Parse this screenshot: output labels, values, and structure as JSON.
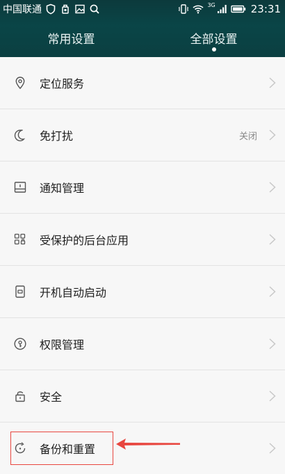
{
  "status_bar": {
    "carrier": "中国联通",
    "network": "3G",
    "time": "23:31"
  },
  "tabs": [
    {
      "label": "常用设置",
      "active": false
    },
    {
      "label": "全部设置",
      "active": true
    }
  ],
  "settings": [
    {
      "label": "定位服务",
      "icon": "location-icon",
      "value": ""
    },
    {
      "label": "免打扰",
      "icon": "moon-icon",
      "value": "关闭"
    },
    {
      "label": "通知管理",
      "icon": "notification-icon",
      "value": ""
    },
    {
      "label": "受保护的后台应用",
      "icon": "apps-grid-icon",
      "value": ""
    },
    {
      "label": "开机自动启动",
      "icon": "autostart-icon",
      "value": ""
    },
    {
      "label": "权限管理",
      "icon": "permission-icon",
      "value": ""
    },
    {
      "label": "安全",
      "icon": "lock-icon",
      "value": ""
    },
    {
      "label": "备份和重置",
      "icon": "backup-icon",
      "value": ""
    }
  ],
  "colors": {
    "header_bg": "#0a4547",
    "highlight": "#e8463f",
    "list_bg": "#f7f7f7"
  }
}
